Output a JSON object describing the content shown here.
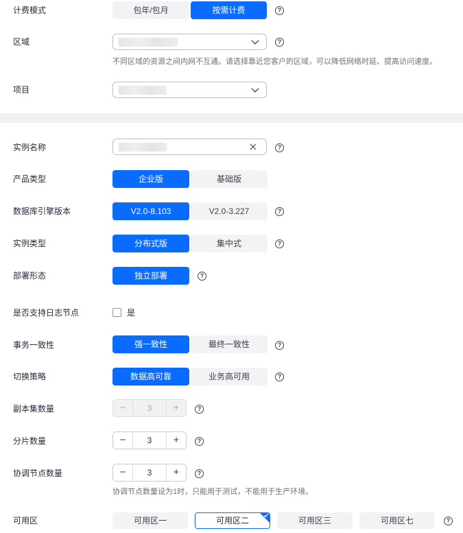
{
  "billing": {
    "label": "计费模式",
    "options": [
      "包年/包月",
      "按需计费"
    ],
    "selected": 1
  },
  "region": {
    "label": "区域",
    "hint": "不同区域的资源之间内网不互通。请选择靠近您客户的区域，可以降低网络时延、提高访问速度。"
  },
  "project": {
    "label": "项目"
  },
  "instance_name": {
    "label": "实例名称"
  },
  "product_type": {
    "label": "产品类型",
    "options": [
      "企业版",
      "基础版"
    ],
    "selected": 0
  },
  "engine_version": {
    "label": "数据库引擎版本",
    "options": [
      "V2.0-8.103",
      "V2.0-3.227"
    ],
    "selected": 0
  },
  "instance_type": {
    "label": "实例类型",
    "options": [
      "分布式版",
      "集中式"
    ],
    "selected": 0
  },
  "deploy_form": {
    "label": "部署形态",
    "options": [
      "独立部署"
    ],
    "selected": 0
  },
  "log_node": {
    "label": "是否支持日志节点",
    "checkbox_label": "是",
    "checked": false
  },
  "consistency": {
    "label": "事务一致性",
    "options": [
      "强一致性",
      "最终一致性"
    ],
    "selected": 0
  },
  "switch_policy": {
    "label": "切换策略",
    "options": [
      "数据高可靠",
      "业务高可用"
    ],
    "selected": 0
  },
  "replica_count": {
    "label": "副本集数量",
    "value": "3",
    "minus": "−",
    "plus": "+"
  },
  "shard_count": {
    "label": "分片数量",
    "value": "3",
    "minus": "−",
    "plus": "+"
  },
  "coordinator_count": {
    "label": "协调节点数量",
    "value": "3",
    "minus": "−",
    "plus": "+",
    "hint": "协调节点数量设为1时，只能用于测试，不能用于生产环境。"
  },
  "availability_zone": {
    "label": "可用区",
    "options": [
      "可用区一",
      "可用区二",
      "可用区三",
      "可用区七"
    ],
    "selected": 1
  },
  "help_glyph": "?",
  "colors": {
    "primary": "#0a6cff",
    "option_bg": "#f2f3f5",
    "separator": "#f0f1f5"
  }
}
